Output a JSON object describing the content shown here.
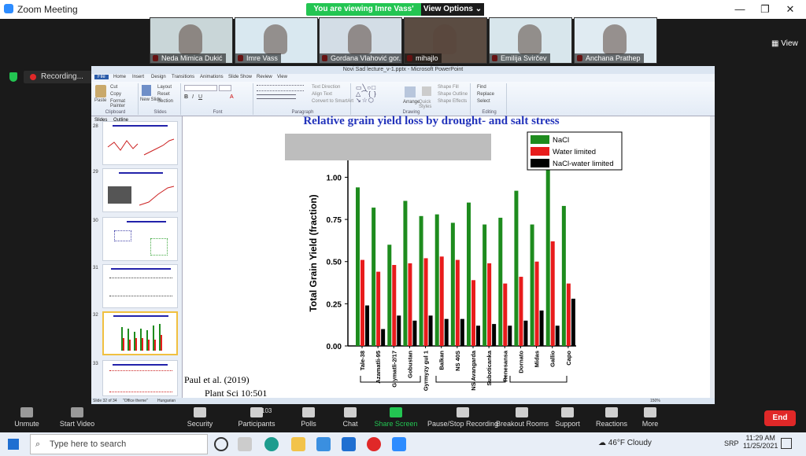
{
  "window": {
    "title": "Zoom Meeting",
    "banner": "You are viewing Imre Vass' screen",
    "view_options": "View Options",
    "view": "View"
  },
  "participants": [
    {
      "name": "Neda Mimica Dukić",
      "bg": "#c9d6d8"
    },
    {
      "name": "Imre Vass",
      "bg": "#d9e8f0"
    },
    {
      "name": "Gordana Vlahović gor...",
      "bg": "#d3dde6"
    },
    {
      "name": "mihajlo",
      "bg": "#5b4c42"
    },
    {
      "name": "Emilija Svirčev",
      "bg": "#d8e6ec"
    },
    {
      "name": "Anchana Prathep",
      "bg": "#e0ebf2"
    }
  ],
  "recording": "Recording...",
  "ppt": {
    "title": "Novi Sad lecture_v-1.pptx - Microsoft PowerPoint",
    "tabs": [
      "File",
      "Home",
      "Insert",
      "Design",
      "Transitions",
      "Animations",
      "Slide Show",
      "Review",
      "View"
    ],
    "groups": [
      "Clipboard",
      "Slides",
      "Font",
      "Paragraph",
      "Drawing",
      "Editing"
    ],
    "ribbon_items": [
      "Paste",
      "Cut",
      "Copy",
      "Format Painter",
      "New Slide",
      "Layout",
      "Reset",
      "Section",
      "Text Direction",
      "Align Text",
      "Convert to SmartArt",
      "Arrange",
      "Quick Styles",
      "Shape Fill",
      "Shape Outline",
      "Shape Effects",
      "Find",
      "Replace",
      "Select"
    ],
    "panel_tabs": [
      "Slides",
      "Outline"
    ],
    "slide_numbers": [
      "28",
      "29",
      "30",
      "31",
      "32",
      "33"
    ],
    "status": {
      "slide": "Slide 32 of 34",
      "theme": "\"Office theme\"",
      "lang": "Hungarian",
      "zoom": "150%"
    }
  },
  "slide": {
    "title": "Relative grain yield loss by drought- and salt stress",
    "ref1": "Paul et al. (2019)",
    "ref2": "Plant Sci 10:501"
  },
  "chart_data": {
    "type": "bar",
    "ylabel": "Total Grain Yield (fraction)",
    "ylim": [
      0,
      1.1
    ],
    "yticks": [
      "0.00",
      "0.25",
      "0.50",
      "0.75",
      "1.00"
    ],
    "categories": [
      "Tale-38",
      "Azamatli-95",
      "Giymatli-2/17",
      "Gobustan",
      "Gyrmyzy gul 1",
      "Balkan",
      "NS 40S",
      "NS Avangarda",
      "Suboticanka",
      "Renesansa",
      "Dornato",
      "Midas",
      "Gallio",
      "Capo"
    ],
    "series": [
      {
        "name": "NaCl",
        "color": "#1e8c1e",
        "values": [
          0.94,
          0.82,
          0.6,
          0.86,
          0.77,
          0.78,
          0.73,
          0.85,
          0.72,
          0.76,
          0.92,
          0.72,
          1.07,
          0.83
        ]
      },
      {
        "name": "Water limited",
        "color": "#e81c1c",
        "values": [
          0.51,
          0.44,
          0.48,
          0.49,
          0.52,
          0.53,
          0.51,
          0.39,
          0.49,
          0.37,
          0.41,
          0.5,
          0.62,
          0.37
        ]
      },
      {
        "name": "NaCl-water limited",
        "color": "#000000",
        "values": [
          0.24,
          0.1,
          0.18,
          0.15,
          0.18,
          0.16,
          0.16,
          0.12,
          0.13,
          0.12,
          0.15,
          0.21,
          0.12,
          0.28
        ]
      }
    ],
    "legend_position": "top-right"
  },
  "bottom": {
    "items": [
      "Unmute",
      "Start Video",
      "Security",
      "Participants",
      "Polls",
      "Chat",
      "Share Screen",
      "Pause/Stop Recording",
      "Breakout Rooms",
      "Support",
      "Reactions",
      "More"
    ],
    "participants_count": "103",
    "end": "End"
  },
  "taskbar": {
    "search": "Type here to search",
    "weather": "46°F  Cloudy",
    "lang": "SRP",
    "time": "11:29 AM",
    "date": "11/25/2021"
  }
}
